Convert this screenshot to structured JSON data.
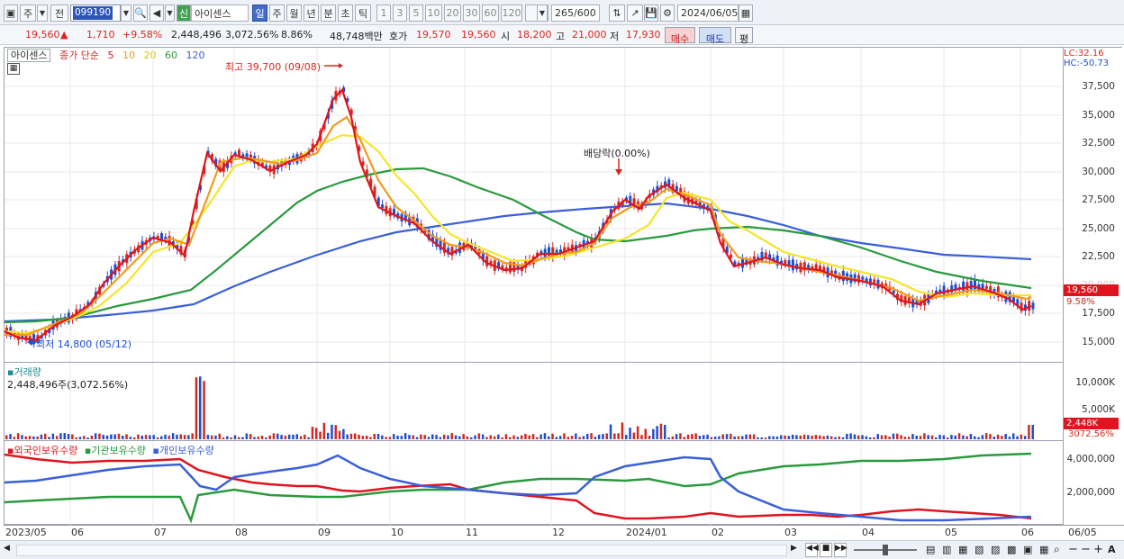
{
  "toolbar": {
    "market_label": "주",
    "prev_label": "전",
    "stock_code": "099190",
    "stock_name": "아이센스",
    "new_badge": "신",
    "periods": [
      "일",
      "주",
      "월",
      "년",
      "분",
      "초",
      "틱"
    ],
    "intervals": [
      "1",
      "3",
      "5",
      "10",
      "20",
      "30",
      "60",
      "120"
    ],
    "count_value": "265",
    "count_total": "/600",
    "date": "2024/06/05"
  },
  "quote": {
    "price": "19,560",
    "change": "1,710",
    "change_pct": "+9.58%",
    "volume": "2,448,496",
    "volume_ratio": "3,072.56%",
    "turnover": "8.86%",
    "amount": "48,748백만",
    "bid_label": "호가",
    "bid": "19,570",
    "ask": "19,560",
    "open_label": "시",
    "open": "18,200",
    "high_label": "고",
    "high": "21,000",
    "low_label": "저",
    "low": "17,930",
    "buy_label": "매수",
    "sell_label": "매도",
    "eval_label": "평"
  },
  "legend": {
    "stock": "아이센스",
    "ma_title": "종가 단순",
    "ma5": "5",
    "ma10": "10",
    "ma20": "20",
    "ma60": "60",
    "ma120": "120"
  },
  "colors": {
    "up": "#d6281f",
    "down": "#1f4fd0",
    "ma5": "#e0141e",
    "ma10": "#f39a1e",
    "ma20": "#f5e52a",
    "ma60": "#2a9a3e",
    "ma120": "#3a5fd8"
  },
  "price_axis": [
    "37,500",
    "35,000",
    "32,500",
    "30,000",
    "27,500",
    "25,000",
    "22,500",
    "17,500",
    "15,000"
  ],
  "price_axis_partial": "20,000",
  "lc": "LC:32.16",
  "hc": "HC:-50.73",
  "current_tag": "19,560",
  "current_pct": "9.58%",
  "annotations": {
    "high": "최고 39,700 (09/08)",
    "low": "최저 14,800 (05/12)",
    "dividend": "배당락(0.00%)"
  },
  "volume_panel": {
    "title": "거래량",
    "value": "2,448,496주(3,072.56%)",
    "axis": [
      "10,000K",
      "5,000K"
    ],
    "tag": "2,448K",
    "tag_pct": "3072.56%"
  },
  "holding_panel": {
    "foreign": "외국인보유수량",
    "inst": "기관보유수량",
    "indiv": "개인보유수량",
    "axis": [
      "4,000,000",
      "2,000,000"
    ]
  },
  "x_axis": [
    "2023/05",
    "06",
    "07",
    "08",
    "09",
    "10",
    "11",
    "12",
    "2024/01",
    "02",
    "03",
    "04",
    "05",
    "06",
    "06/05"
  ]
}
